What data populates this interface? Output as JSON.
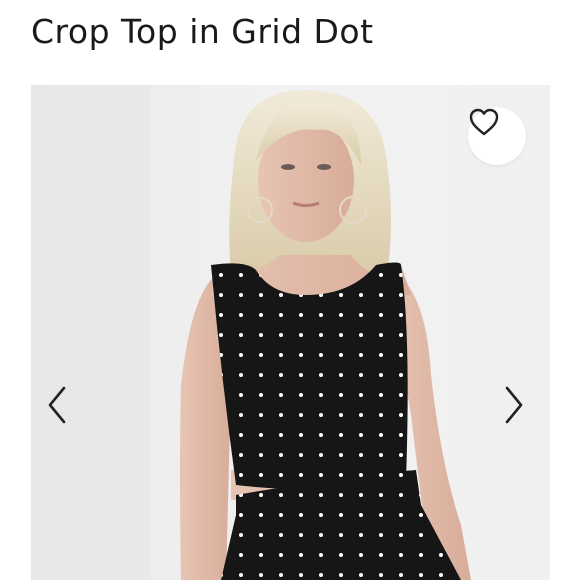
{
  "listing": {
    "title": "Crop Top in Grid Dot"
  },
  "gallery": {
    "favorite_icon": "heart-outline-icon",
    "prev_icon": "chevron-left-icon",
    "next_icon": "chevron-right-icon"
  },
  "colors": {
    "top": "#161616",
    "dots": "#ffffff",
    "background": "#eeeeee",
    "icon": "#222222"
  }
}
